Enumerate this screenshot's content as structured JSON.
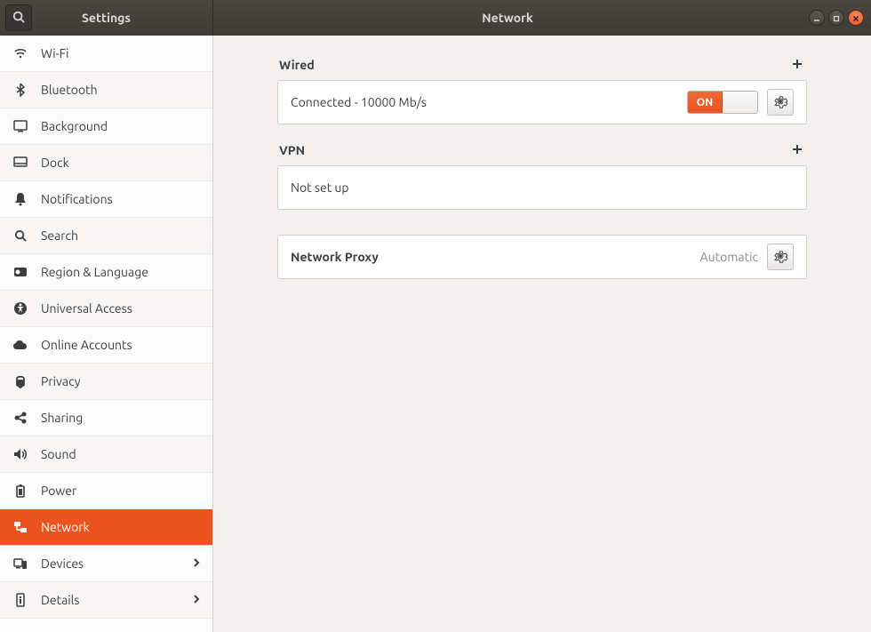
{
  "titlebar": {
    "app_title": "Settings",
    "page_title": "Network"
  },
  "sidebar": {
    "items": [
      {
        "id": "wifi",
        "label": "Wi-Fi",
        "icon": "wifi-icon",
        "chevron": false
      },
      {
        "id": "bluetooth",
        "label": "Bluetooth",
        "icon": "bluetooth-icon",
        "chevron": false
      },
      {
        "id": "background",
        "label": "Background",
        "icon": "display-icon",
        "chevron": false
      },
      {
        "id": "dock",
        "label": "Dock",
        "icon": "dock-icon",
        "chevron": false
      },
      {
        "id": "notifications",
        "label": "Notifications",
        "icon": "bell-icon",
        "chevron": false
      },
      {
        "id": "search",
        "label": "Search",
        "icon": "search-icon",
        "chevron": false
      },
      {
        "id": "region",
        "label": "Region & Language",
        "icon": "globe-icon",
        "chevron": false
      },
      {
        "id": "ua",
        "label": "Universal Access",
        "icon": "accessibility-icon",
        "chevron": false
      },
      {
        "id": "online",
        "label": "Online Accounts",
        "icon": "cloud-icon",
        "chevron": false
      },
      {
        "id": "privacy",
        "label": "Privacy",
        "icon": "lock-icon",
        "chevron": false
      },
      {
        "id": "sharing",
        "label": "Sharing",
        "icon": "share-icon",
        "chevron": false
      },
      {
        "id": "sound",
        "label": "Sound",
        "icon": "speaker-icon",
        "chevron": false
      },
      {
        "id": "power",
        "label": "Power",
        "icon": "power-icon",
        "chevron": false
      },
      {
        "id": "network",
        "label": "Network",
        "icon": "network-icon",
        "chevron": false,
        "selected": true
      },
      {
        "id": "devices",
        "label": "Devices",
        "icon": "devices-icon",
        "chevron": true
      },
      {
        "id": "details",
        "label": "Details",
        "icon": "info-icon",
        "chevron": true
      }
    ]
  },
  "network": {
    "wired": {
      "heading": "Wired",
      "status": "Connected - 10000 Mb/s",
      "switch_label": "ON",
      "switch_state": true
    },
    "vpn": {
      "heading": "VPN",
      "status": "Not set up"
    },
    "proxy": {
      "label": "Network Proxy",
      "value": "Automatic"
    }
  }
}
